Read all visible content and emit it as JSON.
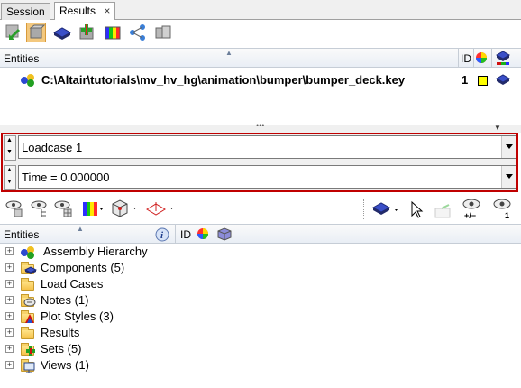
{
  "tabs": [
    {
      "label": "Session"
    },
    {
      "label": "Results",
      "close": "×"
    }
  ],
  "top_panel": {
    "entities_header": "Entities",
    "id_header": "ID",
    "file_row": {
      "path": "C:\\Altair\\tutorials\\mv_hv_hg\\animation\\bumper\\bumper_deck.key",
      "id": "1"
    },
    "splitter_grip": "•••"
  },
  "selectors": {
    "loadcase": {
      "value": "Loadcase 1"
    },
    "time": {
      "value": "Time = 0.000000"
    }
  },
  "bottom_panel": {
    "entities_header": "Entities",
    "id_header": "ID",
    "toolbar_labels": {
      "show_hide": "+/−",
      "isolate": "1"
    },
    "tree": [
      {
        "label": "Assembly Hierarchy",
        "icon": "assembly-icon"
      },
      {
        "label": "Components (5)",
        "icon": "components-icon"
      },
      {
        "label": "Load Cases",
        "icon": "folder-icon"
      },
      {
        "label": "Notes (1)",
        "icon": "notes-icon"
      },
      {
        "label": "Plot Styles (3)",
        "icon": "plot-styles-icon"
      },
      {
        "label": "Results",
        "icon": "folder-icon"
      },
      {
        "label": "Sets  (5)",
        "icon": "sets-icon"
      },
      {
        "label": "Views (1)",
        "icon": "views-icon"
      }
    ]
  },
  "colors": {
    "highlight_frame": "#c00000",
    "header_bg": "#e9eef5",
    "pressed_button": "#f3c87e"
  }
}
